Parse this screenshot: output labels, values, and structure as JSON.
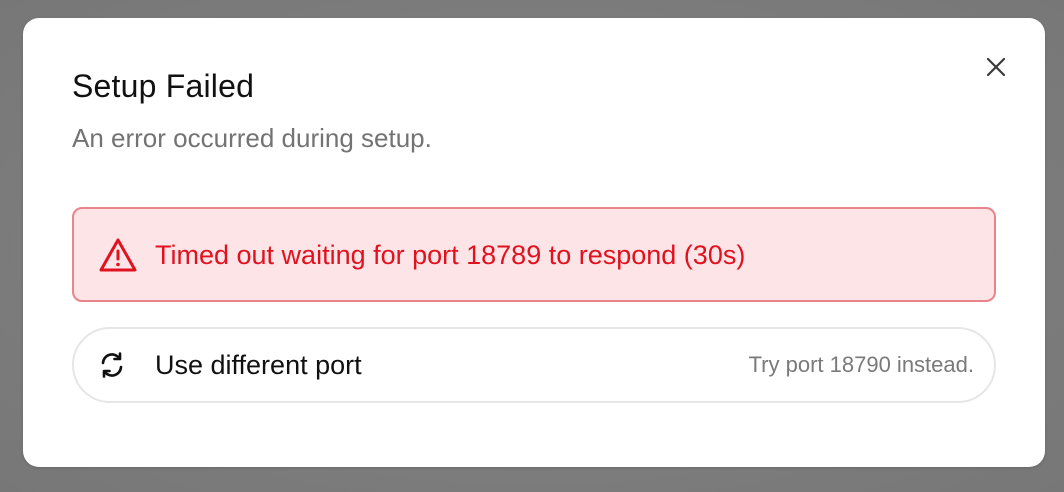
{
  "dialog": {
    "title": "Setup Failed",
    "subtitle": "An error occurred during setup.",
    "close_icon": "close-icon"
  },
  "error": {
    "icon": "warning-triangle-icon",
    "message": "Timed out waiting for port 18789 to respond (30s)",
    "color": "#e0121f",
    "background": "#fde4e6",
    "border": "#e9848c"
  },
  "action": {
    "icon": "refresh-icon",
    "label": "Use different port",
    "hint": "Try port 18790 instead."
  }
}
